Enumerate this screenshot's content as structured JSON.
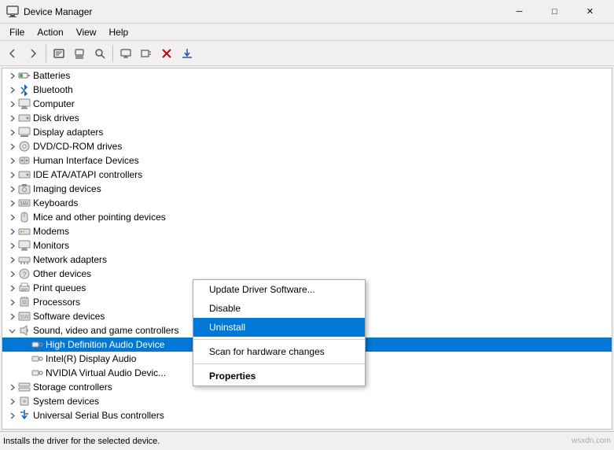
{
  "titleBar": {
    "title": "Device Manager",
    "icon": "🖥",
    "minimizeLabel": "─",
    "maximizeLabel": "□",
    "closeLabel": "✕"
  },
  "menuBar": {
    "items": [
      "File",
      "Action",
      "View",
      "Help"
    ]
  },
  "toolbar": {
    "buttons": [
      {
        "name": "back",
        "icon": "←"
      },
      {
        "name": "forward",
        "icon": "→"
      },
      {
        "name": "properties",
        "icon": "📋"
      },
      {
        "name": "update-driver",
        "icon": "⬆"
      },
      {
        "name": "scan",
        "icon": "🔍"
      },
      {
        "name": "device-mgr",
        "icon": "💻"
      },
      {
        "name": "add-legacy",
        "icon": "📟"
      },
      {
        "name": "uninstall",
        "icon": "✖"
      },
      {
        "name": "download",
        "icon": "⬇"
      }
    ]
  },
  "tree": {
    "items": [
      {
        "id": "batteries",
        "label": "Batteries",
        "icon": "🔋",
        "level": 0,
        "expanded": false
      },
      {
        "id": "bluetooth",
        "label": "Bluetooth",
        "icon": "📶",
        "level": 0,
        "expanded": false
      },
      {
        "id": "computer",
        "label": "Computer",
        "icon": "🖥",
        "level": 0,
        "expanded": false
      },
      {
        "id": "disk-drives",
        "label": "Disk drives",
        "icon": "💾",
        "level": 0,
        "expanded": false
      },
      {
        "id": "display-adapters",
        "label": "Display adapters",
        "icon": "🖥",
        "level": 0,
        "expanded": false
      },
      {
        "id": "dvd-cdrom",
        "label": "DVD/CD-ROM drives",
        "icon": "💿",
        "level": 0,
        "expanded": false
      },
      {
        "id": "human-interface",
        "label": "Human Interface Devices",
        "icon": "⌨",
        "level": 0,
        "expanded": false
      },
      {
        "id": "ide-ata",
        "label": "IDE ATA/ATAPI controllers",
        "icon": "💾",
        "level": 0,
        "expanded": false
      },
      {
        "id": "imaging",
        "label": "Imaging devices",
        "icon": "📷",
        "level": 0,
        "expanded": false
      },
      {
        "id": "keyboards",
        "label": "Keyboards",
        "icon": "⌨",
        "level": 0,
        "expanded": false
      },
      {
        "id": "mice",
        "label": "Mice and other pointing devices",
        "icon": "🖱",
        "level": 0,
        "expanded": false
      },
      {
        "id": "modems",
        "label": "Modems",
        "icon": "📠",
        "level": 0,
        "expanded": false
      },
      {
        "id": "monitors",
        "label": "Monitors",
        "icon": "🖥",
        "level": 0,
        "expanded": false
      },
      {
        "id": "network-adapters",
        "label": "Network adapters",
        "icon": "🌐",
        "level": 0,
        "expanded": false
      },
      {
        "id": "other-devices",
        "label": "Other devices",
        "icon": "❓",
        "level": 0,
        "expanded": false
      },
      {
        "id": "print-queues",
        "label": "Print queues",
        "icon": "🖨",
        "level": 0,
        "expanded": false
      },
      {
        "id": "processors",
        "label": "Processors",
        "icon": "🔲",
        "level": 0,
        "expanded": false
      },
      {
        "id": "software-devices",
        "label": "Software devices",
        "icon": "📦",
        "level": 0,
        "expanded": false
      },
      {
        "id": "sound-video",
        "label": "Sound, video and game controllers",
        "icon": "🔊",
        "level": 0,
        "expanded": true,
        "selected": false
      },
      {
        "id": "high-def-audio",
        "label": "High Definition Audio Device",
        "icon": "🔊",
        "level": 1,
        "selected": true
      },
      {
        "id": "intel-display-audio",
        "label": "Intel(R) Display Audio",
        "icon": "🔊",
        "level": 1,
        "selected": false
      },
      {
        "id": "nvidia-virtual",
        "label": "NVIDIA Virtual Audio Devic...",
        "icon": "🔊",
        "level": 1,
        "selected": false
      },
      {
        "id": "storage-controllers",
        "label": "Storage controllers",
        "icon": "💾",
        "level": 0,
        "expanded": false
      },
      {
        "id": "system-devices",
        "label": "System devices",
        "icon": "🔲",
        "level": 0,
        "expanded": false
      },
      {
        "id": "usb-controllers",
        "label": "Universal Serial Bus controllers",
        "icon": "🔌",
        "level": 0,
        "expanded": false
      }
    ]
  },
  "contextMenu": {
    "items": [
      {
        "id": "update-driver",
        "label": "Update Driver Software...",
        "type": "normal"
      },
      {
        "id": "disable",
        "label": "Disable",
        "type": "normal"
      },
      {
        "id": "uninstall",
        "label": "Uninstall",
        "type": "highlighted"
      },
      {
        "id": "sep1",
        "type": "separator"
      },
      {
        "id": "scan",
        "label": "Scan for hardware changes",
        "type": "normal"
      },
      {
        "id": "sep2",
        "type": "separator"
      },
      {
        "id": "properties",
        "label": "Properties",
        "type": "bold"
      }
    ]
  },
  "statusBar": {
    "text": "Installs the driver for the selected device."
  },
  "watermark": "wsxdn.com"
}
